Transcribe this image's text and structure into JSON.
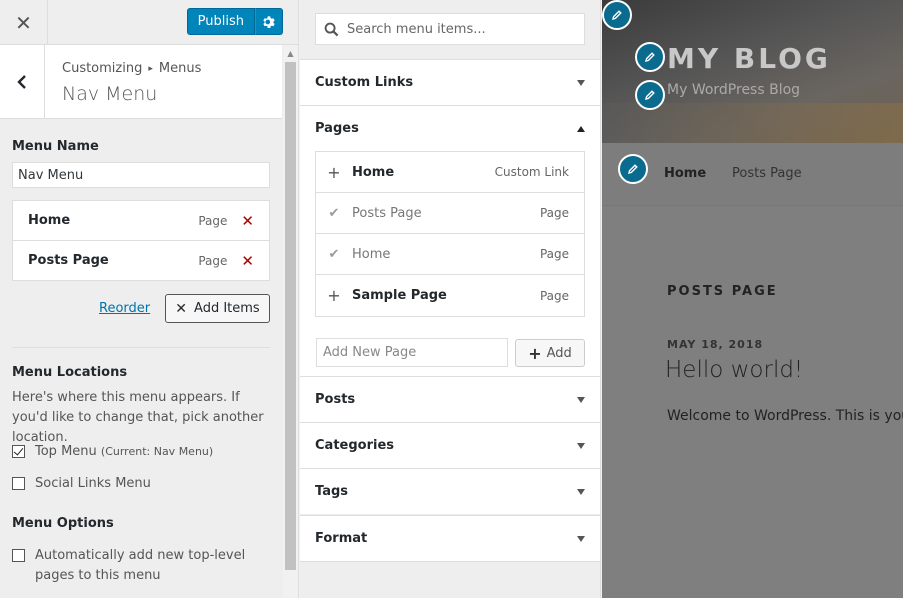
{
  "topbar": {
    "close_label": "✕",
    "publish_label": "Publish"
  },
  "section": {
    "crumb_parent": "Customizing",
    "crumb_sep": "▸",
    "crumb_current": "Menus",
    "title": "Nav Menu"
  },
  "menu": {
    "name_label": "Menu Name",
    "name_value": "Nav Menu",
    "items": [
      {
        "title": "Home",
        "type": "Page"
      },
      {
        "title": "Posts Page",
        "type": "Page"
      }
    ],
    "reorder_label": "Reorder",
    "add_items_label": "Add Items",
    "locations_label": "Menu Locations",
    "locations_desc": "Here's where this menu appears. If you'd like to change that, pick another location.",
    "locations": [
      {
        "label": "Top Menu",
        "note": "(Current: Nav Menu)",
        "checked": true
      },
      {
        "label": "Social Links Menu",
        "note": "",
        "checked": false
      }
    ],
    "options_label": "Menu Options",
    "auto_add_label": "Automatically add new top-level pages to this menu"
  },
  "available": {
    "search_placeholder": "Search menu items...",
    "sections": [
      "Custom Links",
      "Pages",
      "Posts",
      "Categories",
      "Tags",
      "Format"
    ],
    "pages": [
      {
        "title": "Home",
        "type": "Custom Link",
        "state": "add"
      },
      {
        "title": "Posts Page",
        "type": "Page",
        "state": "added"
      },
      {
        "title": "Home",
        "type": "Page",
        "state": "added"
      },
      {
        "title": "Sample Page",
        "type": "Page",
        "state": "add"
      }
    ],
    "new_page_placeholder": "Add New Page",
    "add_label": "Add"
  },
  "preview": {
    "blog_title": "MY BLOG",
    "blog_desc": "My WordPress Blog",
    "nav": [
      "Home",
      "Posts Page"
    ],
    "posts_heading": "POSTS PAGE",
    "post_date": "MAY 18, 2018",
    "post_title": "Hello world!",
    "post_excerpt": "Welcome to WordPress. This is your"
  },
  "colors": {
    "accent": "#0085ba",
    "delete": "#aa0000",
    "link": "#0073aa"
  }
}
